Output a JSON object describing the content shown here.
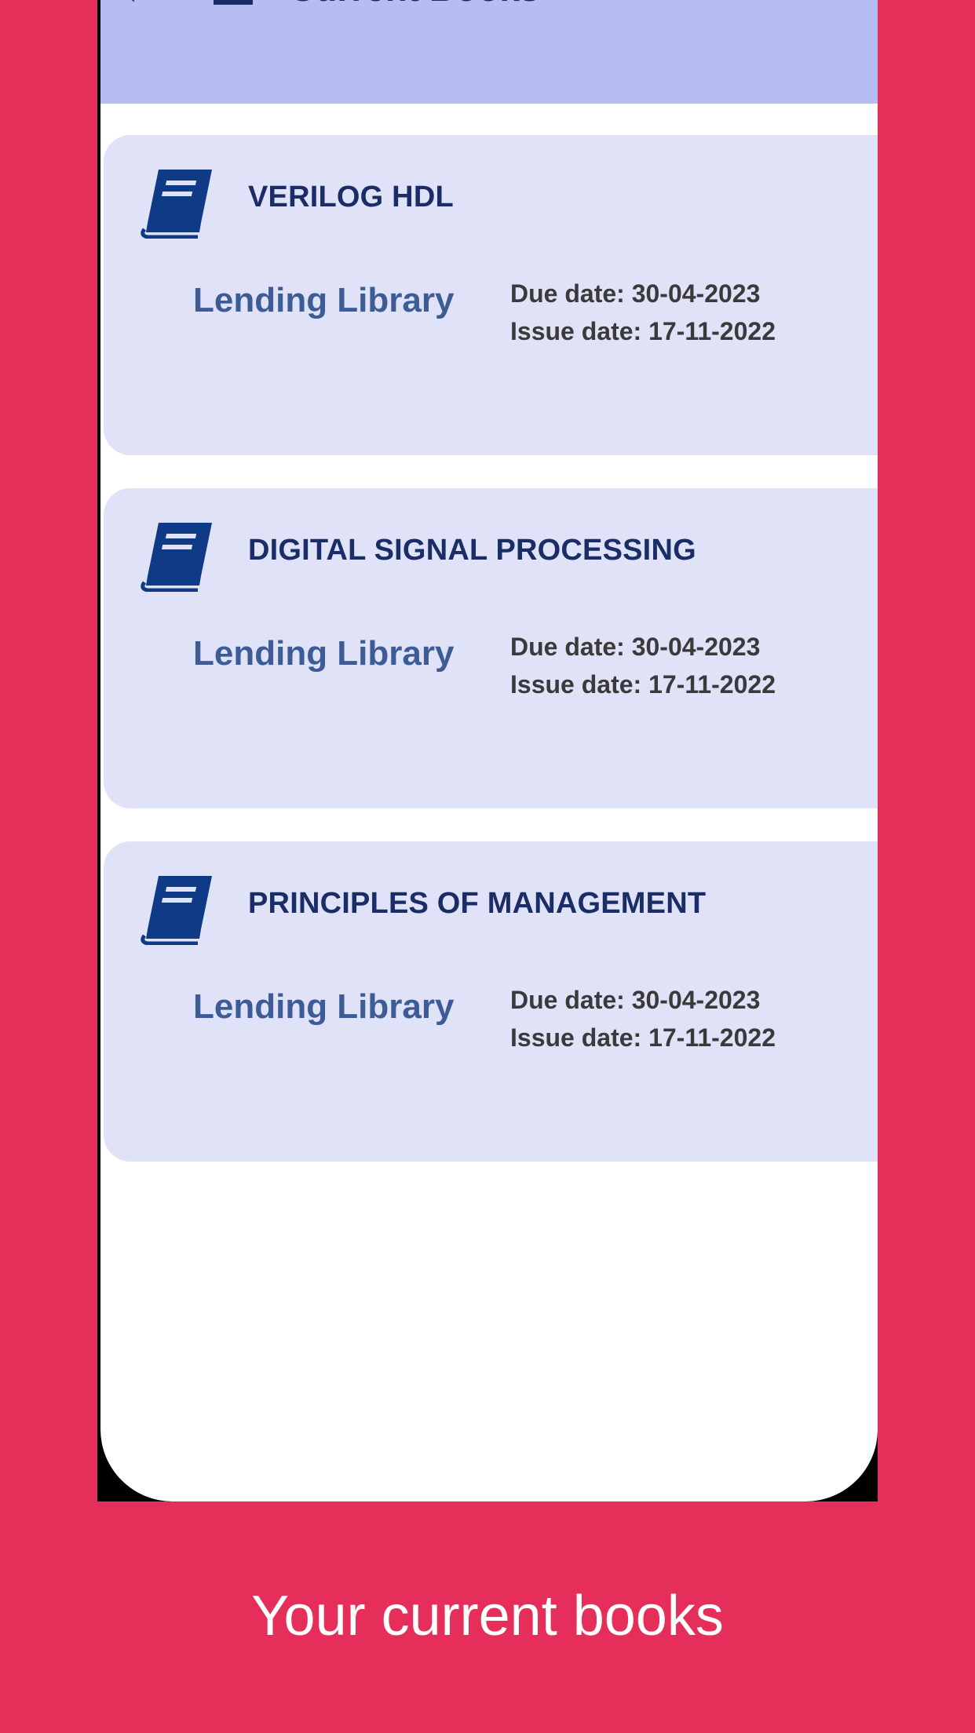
{
  "appbar": {
    "back_glyph": "‹",
    "menu_icon": "menu-icon",
    "title": "Current Books"
  },
  "books": [
    {
      "title": "VERILOG HDL",
      "library": "Lending Library",
      "due": "Due date: 30-04-2023",
      "issue": "Issue date: 17-11-2022",
      "icon": "book-icon"
    },
    {
      "title": "DIGITAL SIGNAL PROCESSING",
      "library": "Lending Library",
      "due": "Due date: 30-04-2023",
      "issue": "Issue date: 17-11-2022",
      "icon": "book-icon"
    },
    {
      "title": "PRINCIPLES OF MANAGEMENT",
      "library": "Lending Library",
      "due": "Due date: 30-04-2023",
      "issue": "Issue date: 17-11-2022",
      "icon": "book-icon"
    }
  ],
  "caption": "Your current books",
  "colors": {
    "background": "#E62E5A",
    "appbar": "#B6BDF2",
    "card": "#E0E3F8",
    "title": "#1B2D66",
    "library": "#3D5C96",
    "icon": "#0E3A86"
  }
}
